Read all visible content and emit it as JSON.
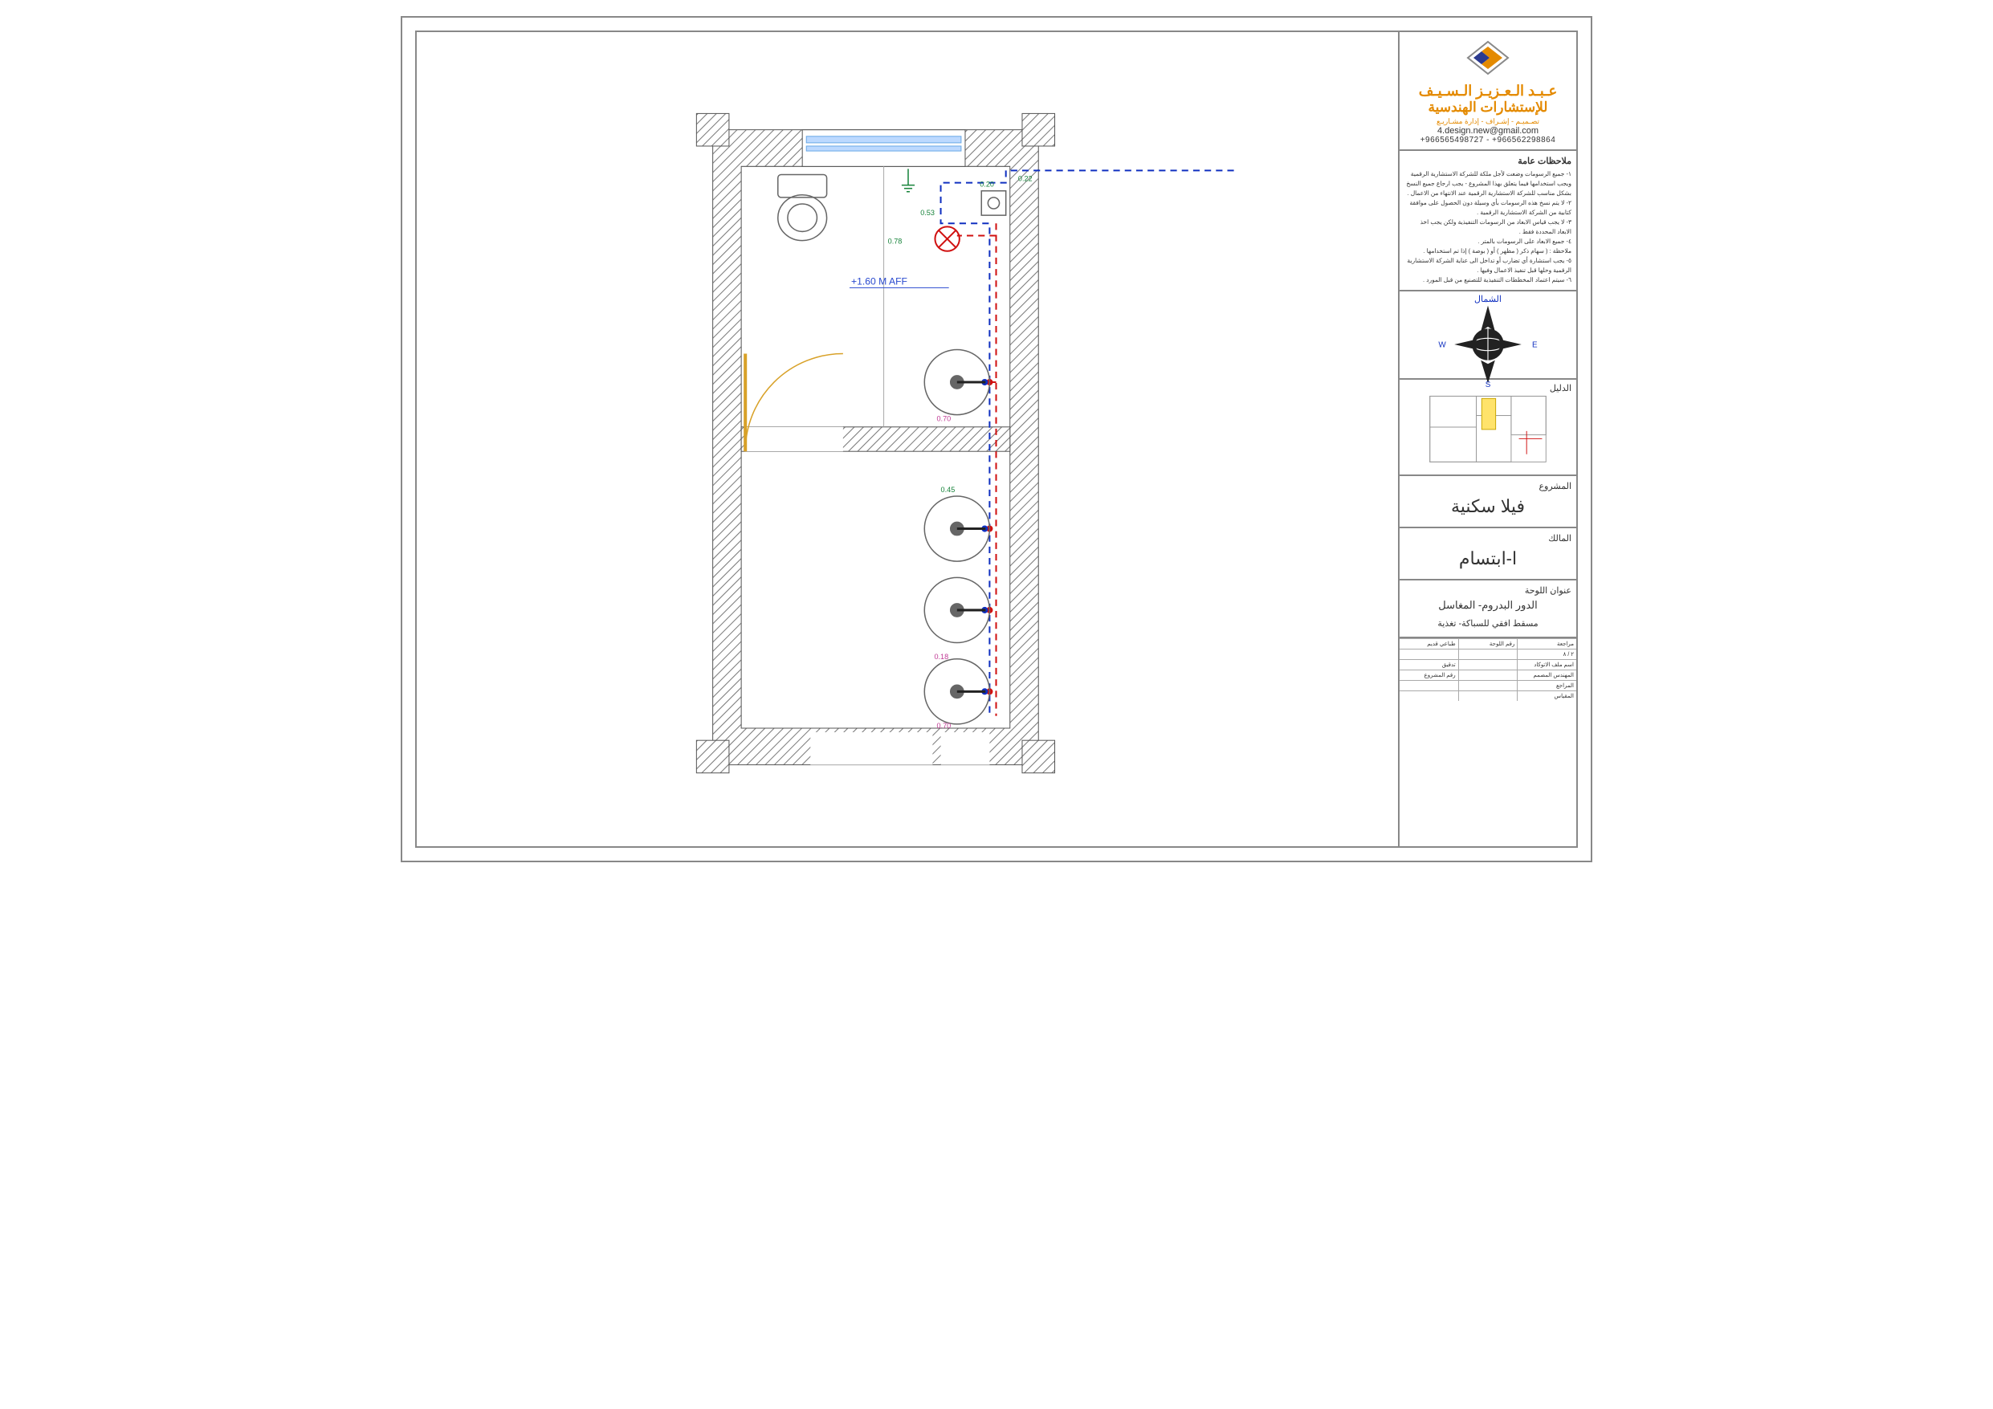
{
  "company": {
    "line1": "عـبـد الـعـزيـز الـسـيـف",
    "line2": "للإستشارات الهندسية",
    "tagline": "تصـميـم - إشـراف - إدارة مشـاريـع",
    "email": "4.design.new@gmail.com",
    "phones": "+966565498727 - +966562298864"
  },
  "notes": {
    "title": "ملاحظات عامة",
    "items": [
      "١- جميع الرسومات وضعت لأجل ملكة للشركة الاستشارية الرقمية ويجب استخدامها فيما يتعلق بهذا المشروع - يجب ارجاع جميع النسخ بشكل مناسب للشركة الاستشارية الرقمية عند الانتهاء من الاعمال .",
      "٢- لا يتم نسخ هذه الرسومات بأي وسيلة دون الحصول على موافقة كتابية من الشركة الاستشارية الرقمية .",
      "٣- لا يجب قياس الابعاد من الرسومات التنفيذية ولكن يجب اخذ الابعاد المحددة فقط .",
      "٤- جميع الابعاد على الرسومات بالمتر .",
      "ملاحظة : ( سهام ذكر ( مظهر ) أو ( بوصة ) إذا تم استخدامها .",
      "٥- يجب استشارة أي تضارب أو تداخل الى عناية الشركة الاستشارية الرقمية وحلها قبل تنفيذ الاعمال وفيها .",
      "٦- سيتم اعتماد المخططات التنفيذية للتصنيع من قبل المورد ."
    ]
  },
  "keyplan": {
    "label": "الدليل"
  },
  "project": {
    "label": "المشروع",
    "value": "فيلا سكنية"
  },
  "owner": {
    "label": "المالك",
    "value": "ا-ابتسام"
  },
  "sheet_title": {
    "label": "عنوان اللوحة",
    "line1": "الدور البدروم- المغاسل",
    "line2": "مسقط افقي للسباكة- تغذية"
  },
  "footer": {
    "rows": [
      {
        "left": "طباعي قديم",
        "right": "مراجعة"
      },
      {
        "left": "",
        "right": "٢ / ٨"
      },
      {
        "left": "تدقيق",
        "right": "اسم ملف الاتوكاد"
      },
      {
        "left": "رقم المشروع",
        "right": "المهندس المصمم"
      },
      {
        "left": "",
        "right": "المراجع"
      },
      {
        "left": "",
        "right": "المقياس"
      }
    ],
    "revNo": "رقم اللوحة"
  },
  "plan": {
    "aff_note": "+1.60 M AFF",
    "dims": {
      "d0_22": "0.22",
      "d0_20": "0.20",
      "d0_53": "0.53",
      "d0_78": "0.78",
      "d0_70": "0.70",
      "d0_45": "0.45",
      "d0_18": "0.18"
    }
  },
  "compass": {
    "n": "الشمال",
    "s": "S",
    "e": "E",
    "w": "W"
  }
}
